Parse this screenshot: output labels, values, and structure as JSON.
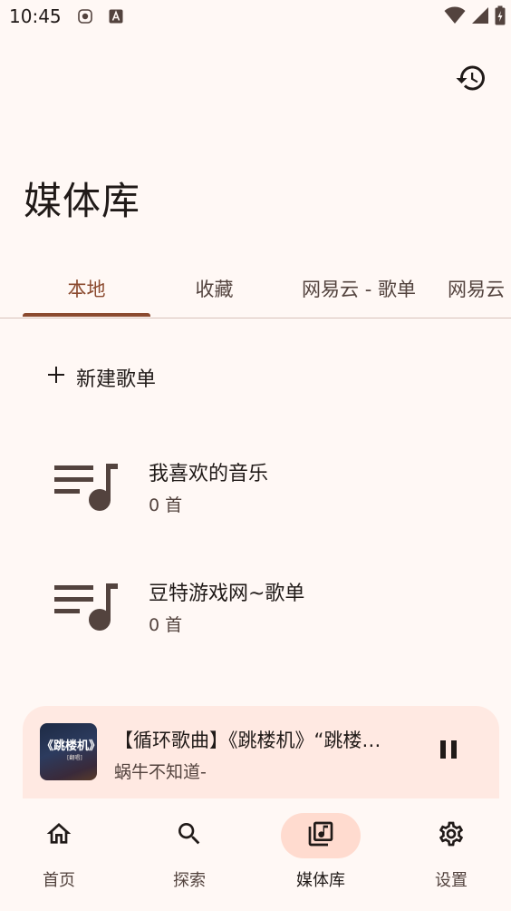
{
  "status_bar": {
    "time": "10:45",
    "icons": [
      "notification-app-icon",
      "notification-a-icon",
      "wifi-icon",
      "signal-icon",
      "battery-icon"
    ]
  },
  "header": {
    "title": "媒体库",
    "history_icon": "history-icon"
  },
  "tabs": [
    {
      "label": "本地",
      "active": true
    },
    {
      "label": "收藏",
      "active": false
    },
    {
      "label": "网易云 - 歌单",
      "active": false
    },
    {
      "label": "网易云",
      "active": false
    }
  ],
  "new_playlist": {
    "label": "新建歌单",
    "icon": "plus-icon"
  },
  "playlists": [
    {
      "title": "我喜欢的音乐",
      "count": "0 首",
      "icon": "playlist-music-icon"
    },
    {
      "title": "豆特游戏网~歌单",
      "count": "0 首",
      "icon": "playlist-music-icon"
    }
  ],
  "mini_player": {
    "title": "【循环歌曲】《跳楼机》“跳楼机 一秒天堂 一秒地狱",
    "artist": "蜗牛不知道-",
    "art_text": "《跳楼机》",
    "art_sub": "[翻唱]",
    "pause_icon": "pause-icon"
  },
  "bottom_nav": [
    {
      "label": "首页",
      "icon": "home-icon",
      "active": false
    },
    {
      "label": "探索",
      "icon": "search-icon",
      "active": false
    },
    {
      "label": "媒体库",
      "icon": "library-music-icon",
      "active": true
    },
    {
      "label": "设置",
      "icon": "gear-icon",
      "active": false
    }
  ],
  "colors": {
    "background": "#fff8f5",
    "accent": "#8b4a2f",
    "player_bg": "#ffe9e2",
    "nav_active_bg": "#ffdbcf"
  }
}
